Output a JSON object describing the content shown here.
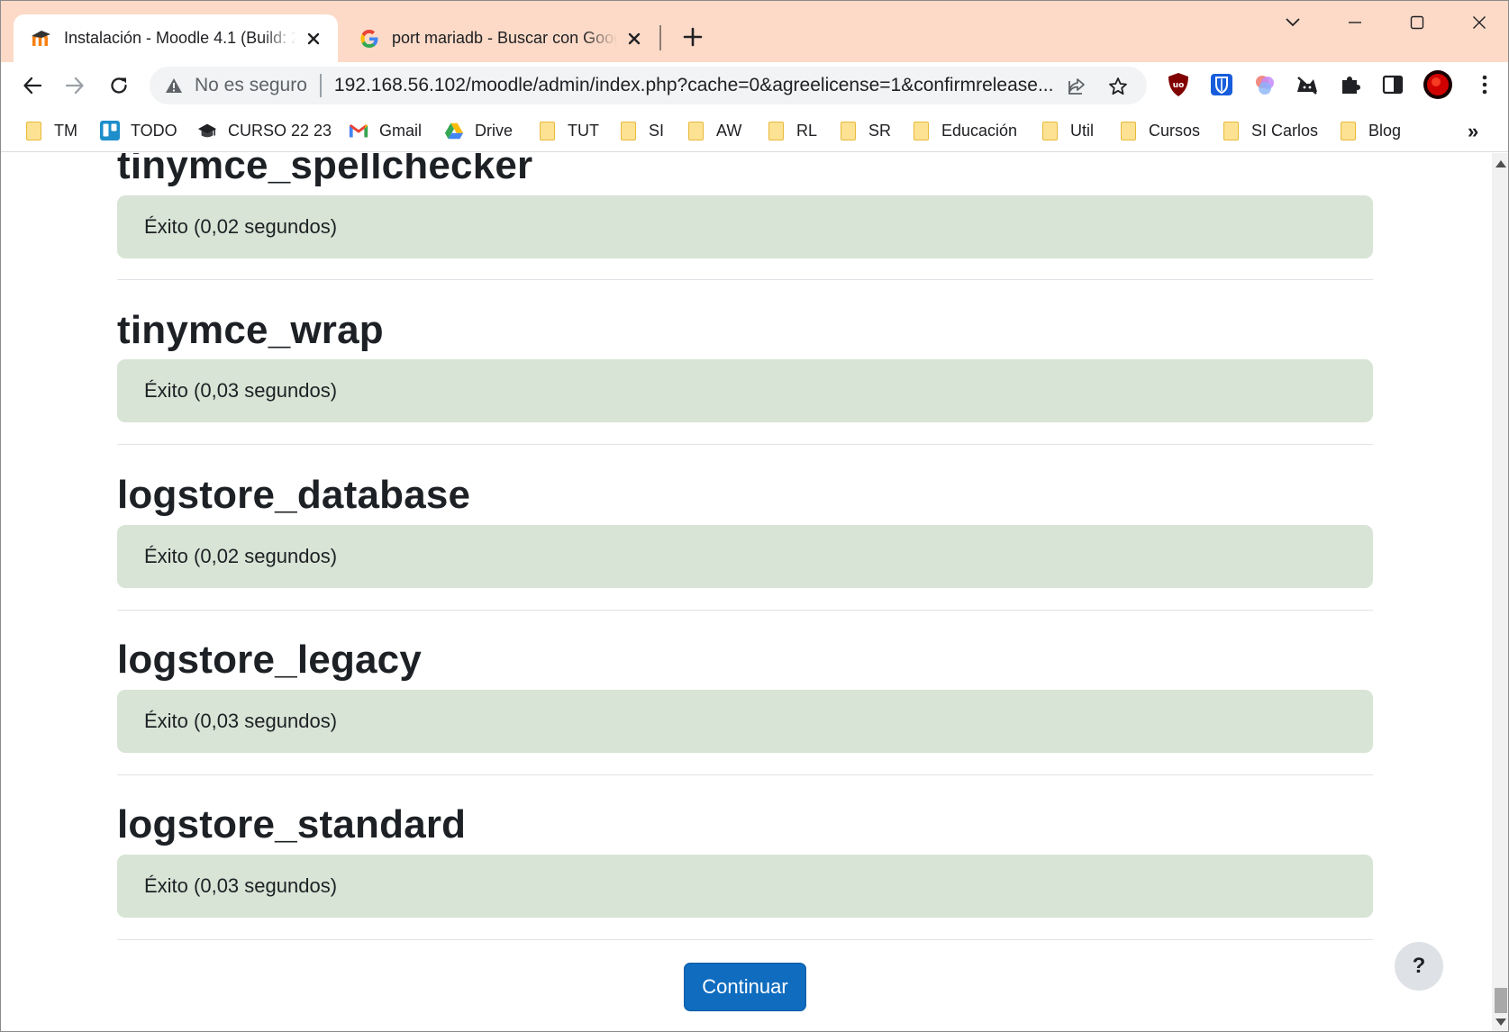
{
  "browser": {
    "tabs": [
      {
        "title": "Instalación - Moodle 4.1 (Build: 2",
        "favicon": "moodle-icon"
      },
      {
        "title": "port mariadb - Buscar con Google",
        "favicon": "google-icon"
      }
    ],
    "omnibox": {
      "security_label": "No es seguro",
      "url": "192.168.56.102/moodle/admin/index.php?cache=0&agreelicense=1&confirmrelease..."
    },
    "bookmarks": [
      {
        "label": "TM",
        "icon": "folder-icon"
      },
      {
        "label": "TODO",
        "icon": "trello-icon"
      },
      {
        "label": "CURSO 22 23",
        "icon": "graduation-cap-icon"
      },
      {
        "label": "Gmail",
        "icon": "gmail-icon"
      },
      {
        "label": "Drive",
        "icon": "drive-icon"
      },
      {
        "label": "TUT",
        "icon": "folder-icon"
      },
      {
        "label": "SI",
        "icon": "folder-icon"
      },
      {
        "label": "AW",
        "icon": "folder-icon"
      },
      {
        "label": "RL",
        "icon": "folder-icon"
      },
      {
        "label": "SR",
        "icon": "folder-icon"
      },
      {
        "label": "Educación",
        "icon": "folder-icon"
      },
      {
        "label": "Util",
        "icon": "folder-icon"
      },
      {
        "label": "Cursos",
        "icon": "folder-icon"
      },
      {
        "label": "SI Carlos",
        "icon": "folder-icon"
      },
      {
        "label": "Blog",
        "icon": "folder-icon"
      }
    ],
    "bookmarks_overflow": "»"
  },
  "page": {
    "plugins": [
      {
        "name": "tinymce_spellchecker",
        "status": "Éxito (0,02 segundos)"
      },
      {
        "name": "tinymce_wrap",
        "status": "Éxito (0,03 segundos)"
      },
      {
        "name": "logstore_database",
        "status": "Éxito (0,02 segundos)"
      },
      {
        "name": "logstore_legacy",
        "status": "Éxito (0,03 segundos)"
      },
      {
        "name": "logstore_standard",
        "status": "Éxito (0,03 segundos)"
      }
    ],
    "continue_label": "Continuar",
    "help_label": "?"
  },
  "colors": {
    "tabstrip": "#fcdac7",
    "success_bg": "#d8e4d5",
    "primary": "#0f6cbf"
  }
}
